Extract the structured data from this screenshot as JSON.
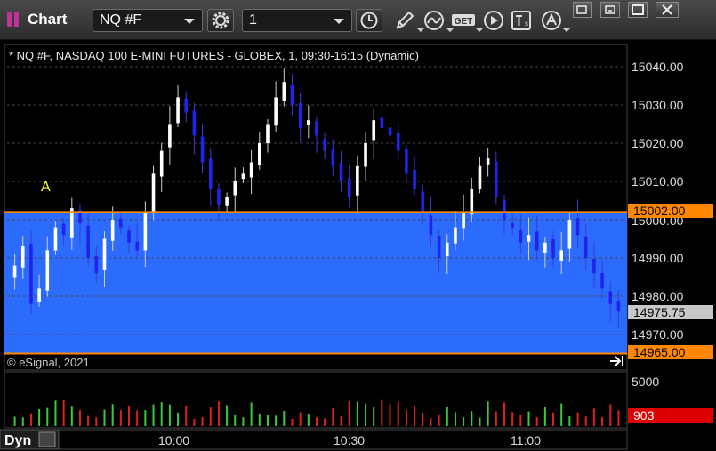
{
  "toolbar": {
    "title": "Chart",
    "symbol": "NQ #F",
    "interval": "1",
    "icons": [
      "gear-icon",
      "clock-icon",
      "pencil-icon",
      "study-icon",
      "get-icon",
      "play-icon",
      "text-icon",
      "alert-icon",
      "restore-icon",
      "minimize-icon",
      "maximize-icon",
      "close-icon"
    ]
  },
  "chart": {
    "header": "* NQ #F, NASDAQ 100 E-MINI FUTURES - GLOBEX, 1, 09:30-16:15 (Dynamic)",
    "copyright": "© eSignal, 2021",
    "annotation": "A",
    "price_labels": [
      "15040.00",
      "15030.00",
      "15020.00",
      "15010.00",
      "15000.00",
      "14990.00",
      "14980.00",
      "14970.00"
    ],
    "marker_upper": "15002.00",
    "marker_lower": "14965.00",
    "marker_last": "14975.75",
    "volume_label": "5000",
    "volume_last": "903",
    "time_labels": [
      "10:00",
      "10:30",
      "11:00"
    ],
    "bottom_mode": "Dyn",
    "colors": {
      "up": "#ffffff",
      "down": "#2222ee",
      "band": "#2b6cff",
      "orange": "#ff8800",
      "vol_up": "#3cc83c",
      "vol_down": "#e02020"
    }
  },
  "chart_data": {
    "type": "candlestick",
    "symbol": "NQ #F",
    "interval_minutes": 1,
    "y_ticks": [
      14970,
      14980,
      14990,
      15000,
      15010,
      15020,
      15030,
      15040
    ],
    "x_ticks": [
      "10:00",
      "10:30",
      "11:00"
    ],
    "horizontal_lines": [
      15002.0,
      14965.0
    ],
    "shaded_range": [
      14965.0,
      15002.0
    ],
    "last_price": 14975.75,
    "last_volume": 903,
    "volume_axis_label": 5000,
    "close_approx": [
      14988,
      14993,
      14978,
      14982,
      14992,
      14998,
      14996,
      15003,
      14999,
      14990,
      14986,
      14995,
      15000,
      14998,
      14994,
      14992,
      15002,
      15012,
      15018,
      15025,
      15032,
      15028,
      15022,
      15015,
      15008,
      15004,
      15006,
      15010,
      15012,
      15015,
      15020,
      15025,
      15032,
      15036,
      15030,
      15024,
      15026,
      15022,
      15018,
      15014,
      15010,
      15006,
      15014,
      15020,
      15026,
      15024,
      15022,
      15018,
      15012,
      15008,
      15002,
      14996,
      14990,
      14994,
      14998,
      15002,
      15008,
      15014,
      15016,
      15006,
      15000,
      14998,
      14994,
      14996,
      14992,
      14994,
      14990,
      14992,
      15000,
      14996,
      14990,
      14986,
      14982,
      14978,
      14976
    ]
  }
}
